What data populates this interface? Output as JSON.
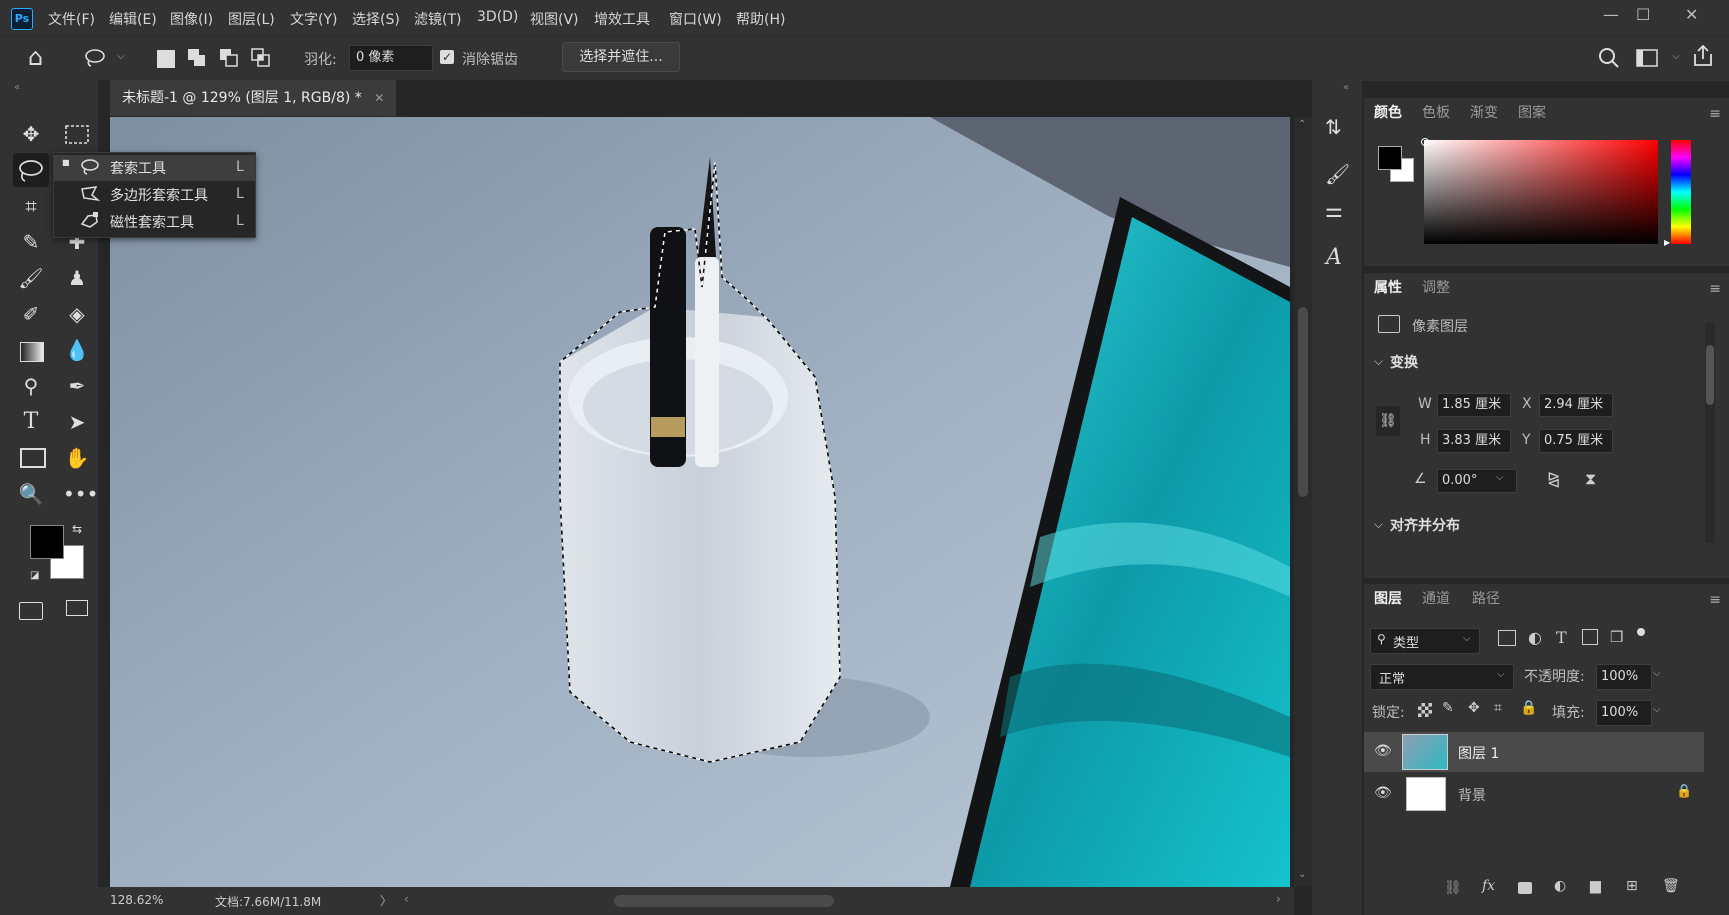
{
  "app": {
    "logo": "Ps"
  },
  "menubar": {
    "items": [
      "文件(F)",
      "编辑(E)",
      "图像(I)",
      "图层(L)",
      "文字(Y)",
      "选择(S)",
      "滤镜(T)",
      "3D(D)",
      "视图(V)",
      "增效工具",
      "窗口(W)",
      "帮助(H)"
    ]
  },
  "window_controls": {
    "minimize": "—",
    "maximize": "☐",
    "close": "✕"
  },
  "options": {
    "feather_label": "羽化:",
    "feather_value": "0 像素",
    "antialias_label": "消除锯齿",
    "antialias_checked": true,
    "select_mask_button": "选择并遮住..."
  },
  "document": {
    "tab_title": "未标题-1 @ 129% (图层 1, RGB/8) *",
    "zoom": "128.62%",
    "doc_info": "文档:7.66M/11.8M"
  },
  "flyout": {
    "items": [
      {
        "label": "套索工具",
        "shortcut": "L",
        "active": true
      },
      {
        "label": "多边形套索工具",
        "shortcut": "L",
        "active": false
      },
      {
        "label": "磁性套索工具",
        "shortcut": "L",
        "active": false
      }
    ]
  },
  "color_panel": {
    "tabs": [
      "颜色",
      "色板",
      "渐变",
      "图案"
    ],
    "foreground": "#000000",
    "background": "#ffffff",
    "hue_color": "#ff0000"
  },
  "properties_panel": {
    "tabs": [
      "属性",
      "调整"
    ],
    "layer_type": "像素图层",
    "transform_header": "变换",
    "w_label": "W",
    "w_value": "1.85 厘米",
    "h_label": "H",
    "h_value": "3.83 厘米",
    "x_label": "X",
    "x_value": "2.94 厘米",
    "y_label": "Y",
    "y_value": "0.75 厘米",
    "angle_value": "0.00°",
    "align_header": "对齐并分布"
  },
  "layers_panel": {
    "tabs": [
      "图层",
      "通道",
      "路径"
    ],
    "filter_label": "类型",
    "blend_mode": "正常",
    "opacity_label": "不透明度:",
    "opacity_value": "100%",
    "lock_label": "锁定:",
    "fill_label": "填充:",
    "fill_value": "100%",
    "layers": [
      {
        "name": "图层 1",
        "visible": true,
        "selected": true,
        "locked": false
      },
      {
        "name": "背景",
        "visible": true,
        "selected": false,
        "locked": true
      }
    ]
  },
  "colors": {
    "accent": "#31a8ff",
    "teal": "#18b5bf",
    "panel_bg": "#323232"
  }
}
